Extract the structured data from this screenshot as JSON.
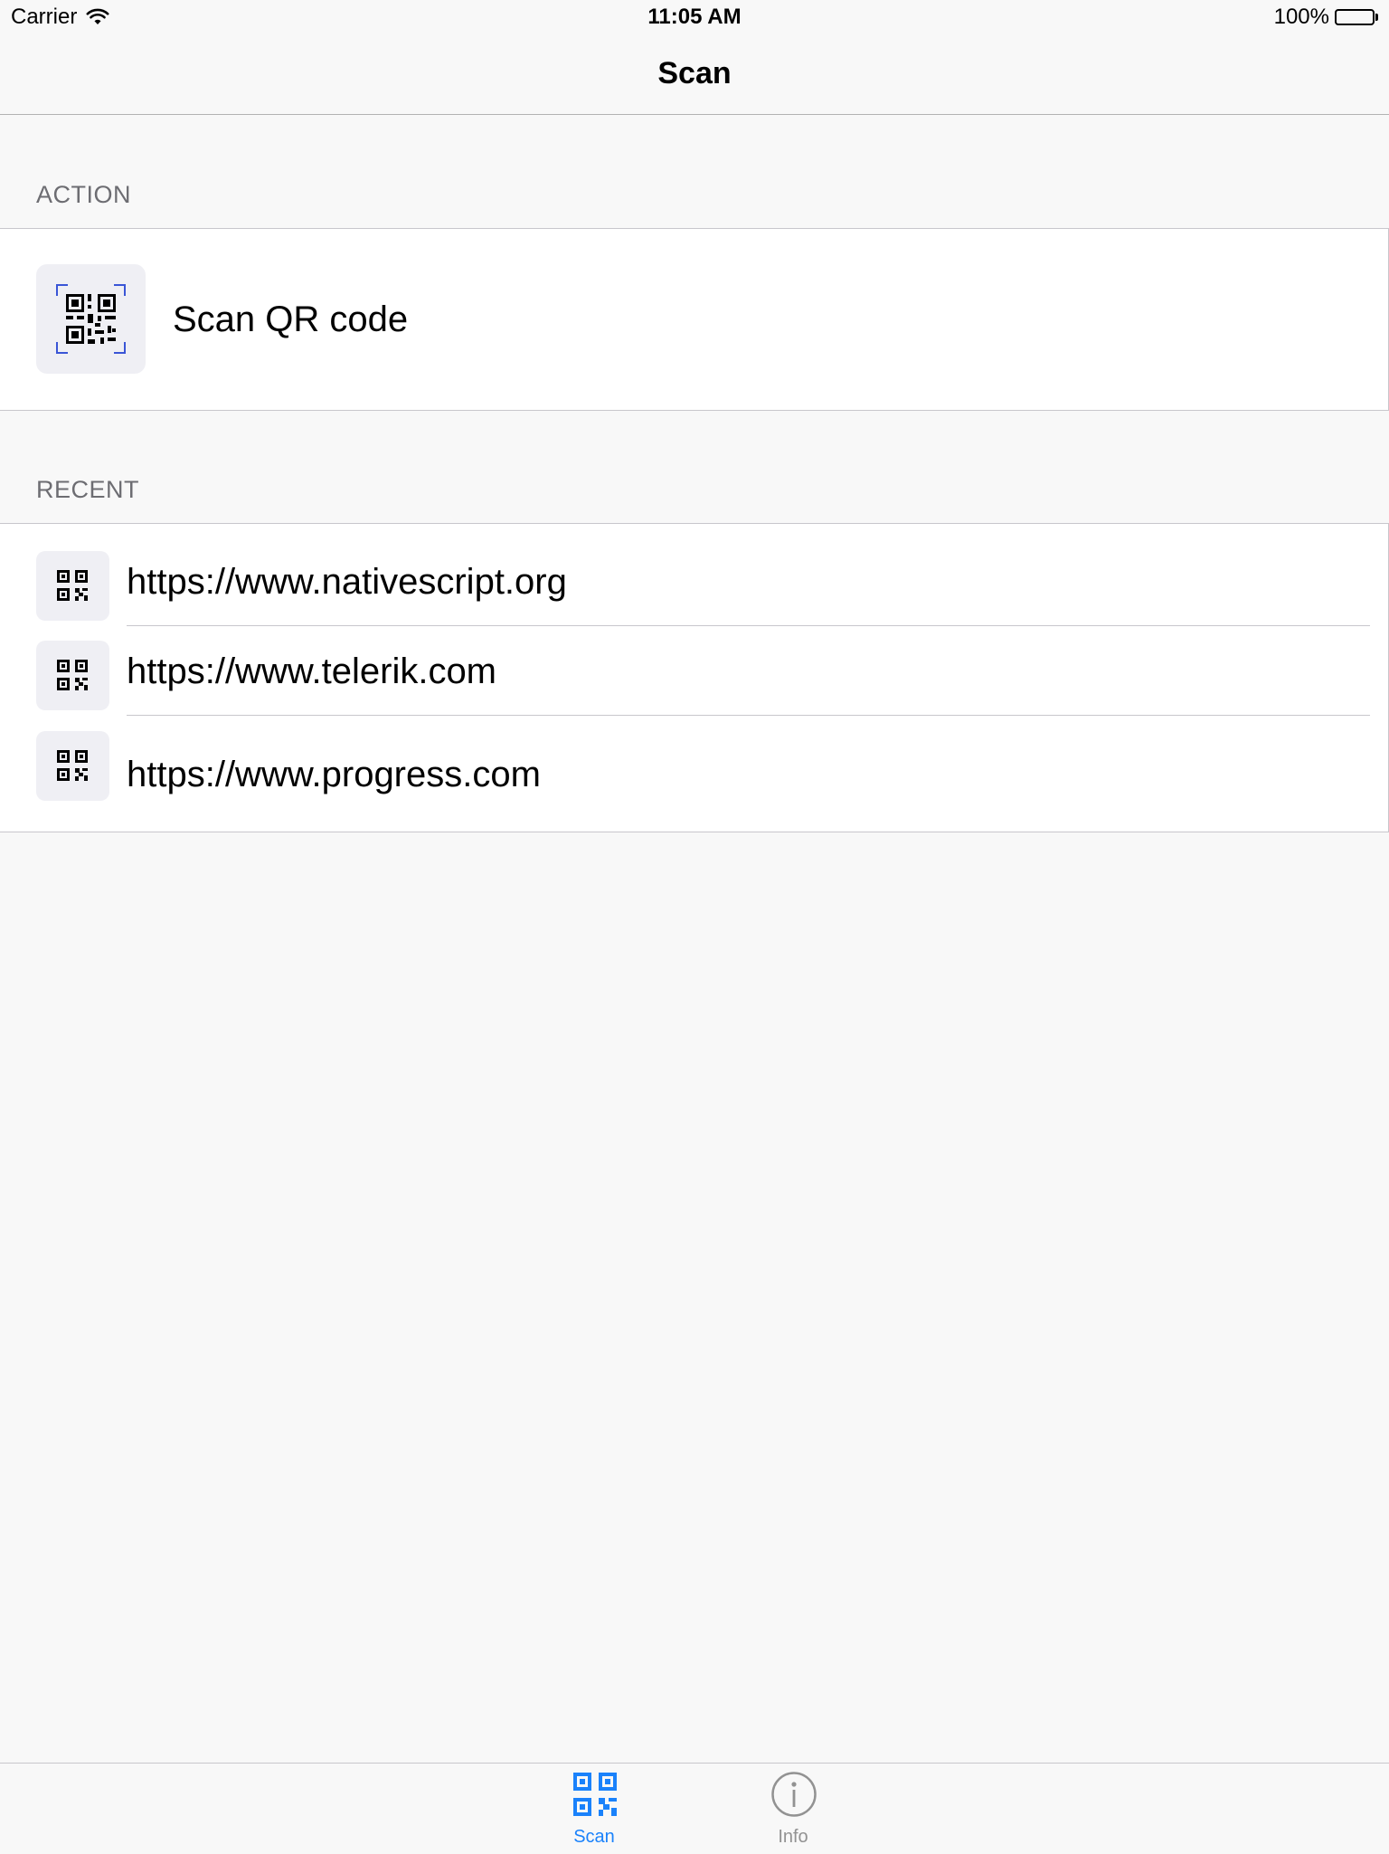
{
  "status_bar": {
    "carrier": "Carrier",
    "time": "11:05 AM",
    "battery": "100%",
    "battery_level": 1.0
  },
  "nav": {
    "title": "Scan"
  },
  "action_section": {
    "header": "ACTION",
    "item": {
      "label": "Scan QR code",
      "icon": "qr-scan-icon"
    }
  },
  "recent_section": {
    "header": "RECENT",
    "items": [
      {
        "label": "https://www.nativescript.org",
        "icon": "qr-code-icon"
      },
      {
        "label": "https://www.telerik.com",
        "icon": "qr-code-icon"
      },
      {
        "label": "https://www.progress.com",
        "icon": "qr-code-icon"
      }
    ]
  },
  "tab_bar": {
    "tabs": [
      {
        "label": "Scan",
        "icon": "qr-code-icon",
        "selected": true
      },
      {
        "label": "Info",
        "icon": "info-icon",
        "selected": false
      }
    ],
    "active_color": "#1a82fb",
    "inactive_color": "#929292"
  },
  "colors": {
    "scan_corner_accent": "#3a55d6"
  }
}
